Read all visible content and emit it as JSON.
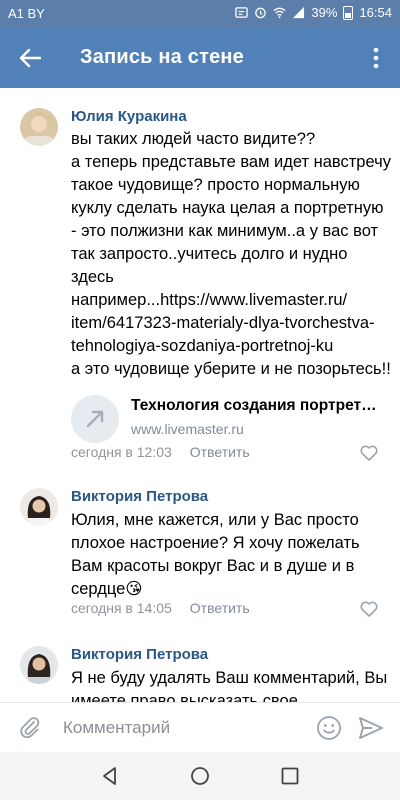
{
  "status": {
    "carrier": "A1 BY",
    "battery": "39%",
    "time": "16:54"
  },
  "appbar": {
    "title": "Запись на стене",
    "back_icon": "arrow-left-icon",
    "menu_icon": "more-vertical-icon"
  },
  "comments": [
    {
      "author": "Юлия Куракина",
      "text": "вы таких людей часто видите??\nа теперь представьте вам идет навстречу такое чудовище? просто нормальную куклу сделать наука целая а портретную - это полжизни как минимум..а у вас вот так запросто..учитесь долго и нудно здесь например...https://www.livemaster.ru/ item/6417323-materialy-dlya-tvorchestva-tehnologiya-sozdaniya-portretnoj-ku\nа это чудовище уберите и не позорьтесь!!",
      "link_title": "Технология создания портрет…",
      "link_url": "www.livemaster.ru",
      "time": "сегодня в 12:03",
      "reply": "Ответить"
    },
    {
      "author": "Виктория Петрова",
      "text": "Юлия, мне кажется, или у Вас просто плохое настроение? Я хочу пожелать Вам красоты вокруг Вас и в душе и в сердце😘",
      "time": "сегодня в 14:05",
      "reply": "Ответить"
    },
    {
      "author": "Виктория Петрова",
      "text": "Я не буду удалять Ваш комментарий, Вы имеете право высказать свое"
    }
  ],
  "input": {
    "placeholder": "Комментарий"
  },
  "colors": {
    "appbar": "#5181b8",
    "statusbar": "#5b7faa",
    "link_name": "#2a5885"
  }
}
